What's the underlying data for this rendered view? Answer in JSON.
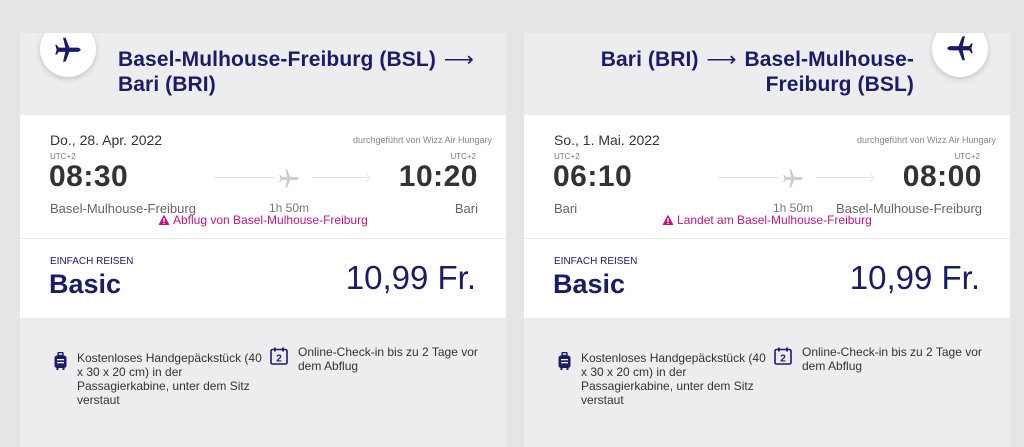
{
  "outbound": {
    "route": {
      "from": "Basel-Mulhouse-Freiburg (BSL)",
      "arrow": "⟶",
      "to": "Bari (BRI)"
    },
    "date": "Do., 28. Apr. 2022",
    "operator": "durchgeführt von Wizz Air Hungary",
    "departure": {
      "tz": "UTC+2",
      "time": "08:30",
      "city": "Basel-Mulhouse-Freiburg"
    },
    "arrival": {
      "tz": "UTC+2",
      "time": "10:20",
      "city": "Bari"
    },
    "duration": "1h 50m",
    "notice": "Abflug von Basel-Mulhouse-Freiburg",
    "fare": {
      "type": "EINFACH REISEN",
      "name": "Basic",
      "price": "10,99 Fr."
    },
    "features": {
      "bag": "Kostenloses Handgepäckstück (40 x 30 x 20 cm) in der Passagierkabine, unter dem Sitz verstaut",
      "checkin": "Online-Check-in bis zu 2 Tage vor dem Abflug",
      "checkin_icon_number": "2"
    }
  },
  "return": {
    "route": {
      "from": "Bari (BRI)",
      "arrow": "⟶",
      "to": "Basel-Mulhouse-Freiburg (BSL)"
    },
    "date": "So., 1. Mai. 2022",
    "operator": "durchgeführt von Wizz Air Hungary",
    "departure": {
      "tz": "UTC+2",
      "time": "06:10",
      "city": "Bari"
    },
    "arrival": {
      "tz": "UTC+2",
      "time": "08:00",
      "city": "Basel-Mulhouse-Freiburg"
    },
    "duration": "1h 50m",
    "notice": "Landet am Basel-Mulhouse-Freiburg",
    "fare": {
      "type": "EINFACH REISEN",
      "name": "Basic",
      "price": "10,99 Fr."
    },
    "features": {
      "bag": "Kostenloses Handgepäckstück (40 x 30 x 20 cm) in der Passagierkabine, unter dem Sitz verstaut",
      "checkin": "Online-Check-in bis zu 2 Tage vor dem Abflug",
      "checkin_icon_number": "2"
    }
  },
  "colors": {
    "brand": "#1b1b68",
    "notice": "#c1167f",
    "panel": "#ededf0",
    "background": "#e5e5e7"
  },
  "icons": [
    "plane-icon",
    "warning-icon",
    "luggage-icon",
    "calendar-icon"
  ]
}
